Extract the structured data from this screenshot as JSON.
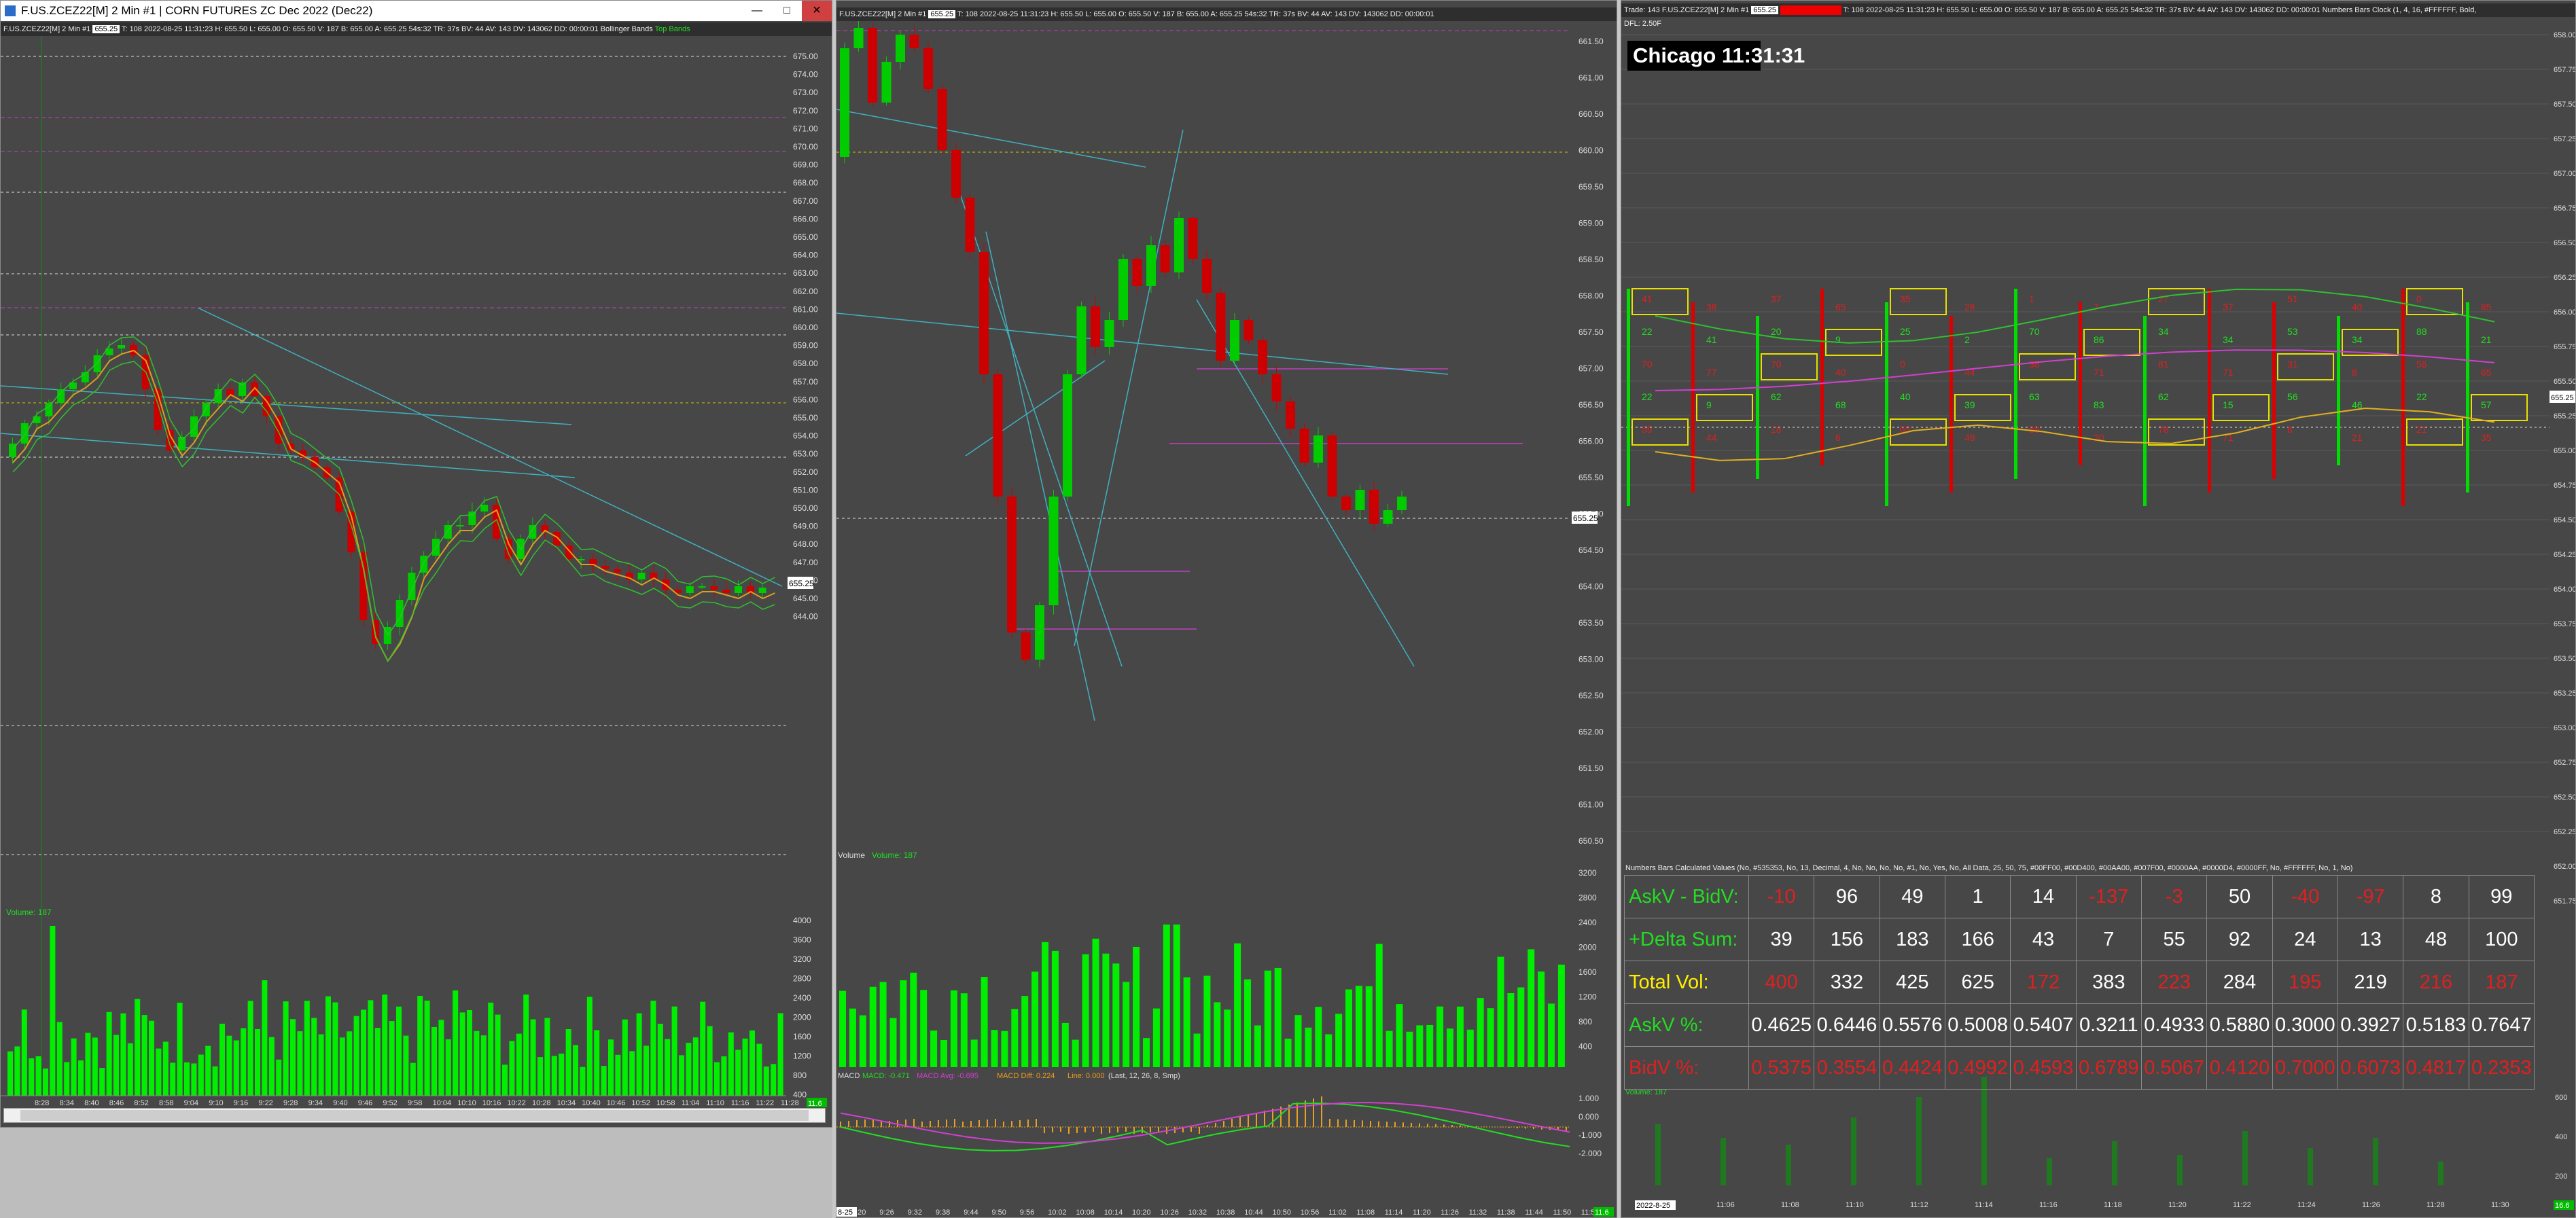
{
  "window1": {
    "title": "F.US.ZCEZ22[M]  2 Min   #1 | CORN FUTURES ZC Dec 2022 (Dec22)",
    "info_symbol": "F.US.ZCEZ22[M]  2 Min  #1",
    "info_price_badge": "655.25",
    "info_rest": "T: 108   2022-08-25 11:31:23 H: 655.50 L: 655.00 O: 655.50 V: 187 B: 655.00 A: 655.25 54s:32 TR: 37s BV: 44 AV: 143 DV: 143062 DD: 00:00:01",
    "indicator": "Bollinger Bands",
    "indicator_flag": "Top Bands",
    "price_labels": [
      "675.00",
      "674.00",
      "673.00",
      "672.00",
      "671.00",
      "670.00",
      "669.00",
      "668.00",
      "667.00",
      "666.00",
      "665.00",
      "664.00",
      "663.00",
      "662.00",
      "661.00",
      "660.00",
      "659.00",
      "658.00",
      "657.00",
      "656.00",
      "655.00",
      "654.00",
      "653.00",
      "652.00",
      "651.00",
      "650.00",
      "649.00",
      "648.00",
      "647.00",
      "646.00",
      "645.00",
      "644.00"
    ],
    "last_price_tag": "655.25",
    "volume_label": "Volume: 187",
    "volume_labels": [
      "4000",
      "3600",
      "3200",
      "2800",
      "2400",
      "2000",
      "1600",
      "1200",
      "800",
      "400"
    ],
    "time_labels": [
      "8:28",
      "8:34",
      "8:40",
      "8:46",
      "8:52",
      "8:58",
      "9:04",
      "9:10",
      "9:16",
      "9:22",
      "9:28",
      "9:34",
      "9:40",
      "9:46",
      "9:52",
      "9:58",
      "10:04",
      "10:10",
      "10:16",
      "10:22",
      "10:28",
      "10:34",
      "10:40",
      "10:46",
      "10:52",
      "10:58",
      "11:04",
      "11:10",
      "11:16",
      "11:22",
      "11:28"
    ],
    "zoom_tag": "11.6"
  },
  "window2": {
    "info_symbol": "F.US.ZCEZ22[M]  2 Min  #1",
    "info_price_badge": "655.25",
    "info_rest": "T: 108   2022-08-25 11:31:23 H: 655.50 L: 655.00 O: 655.50 V: 187 B: 655.00 A: 655.25 54s:32 TR: 37s BV: 44 AV: 143 DV: 143062 DD: 00:00:01",
    "price_labels": [
      "661.50",
      "661.00",
      "660.50",
      "660.00",
      "659.50",
      "659.00",
      "658.50",
      "658.00",
      "657.50",
      "657.00",
      "656.50",
      "656.00",
      "655.50",
      "655.00",
      "654.50",
      "654.00",
      "653.50",
      "653.00",
      "652.50",
      "652.00",
      "651.50",
      "651.00",
      "650.50"
    ],
    "last_price_tag": "655.25",
    "volume_label": "Volume",
    "volume_value": "Volume: 187",
    "volume_labels": [
      "3200",
      "2800",
      "2400",
      "2000",
      "1600",
      "1200",
      "800",
      "400"
    ],
    "macd_label": "MACD",
    "macd_line": "MACD: -0.471",
    "macd_avg": "MACD Avg: -0.695",
    "macd_diff": "MACD Diff: 0.224",
    "macd_zero": "Line: 0.000",
    "macd_params": "(Last, 12, 26, 8, Smp)",
    "macd_axis": [
      "1.000",
      "0.000",
      "-1.000",
      "-2.000"
    ],
    "time_labels": [
      "9:20",
      "9:26",
      "9:32",
      "9:38",
      "9:44",
      "9:50",
      "9:56",
      "10:02",
      "10:08",
      "10:14",
      "10:20",
      "10:26",
      "10:32",
      "10:38",
      "10:44",
      "10:50",
      "10:56",
      "11:02",
      "11:08",
      "11:14",
      "11:20",
      "11:26",
      "11:32",
      "11:38",
      "11:44",
      "11:50",
      "11:56"
    ],
    "date_tag": "8-25",
    "zoom_tag": "11.6"
  },
  "window3": {
    "info_trade": "Trade: 143",
    "info_symbol": "F.US.ZCEZ22[M]  2 Min  #1",
    "info_price_badge": "655.25",
    "info_rest": "T: 108   2022-08-25 11:31:23 H: 655.50 L: 655.00 O: 655.50 V: 187 B: 655.00 A: 655.25 54s:32 TR: 37s BV: 44 AV: 143 DV: 143062 DD: 00:00:01",
    "info_study": "Numbers Bars  Clock   (1, 4, 16, #FFFFFF, Bold,",
    "info_line2": "DFL: 2.50F",
    "clock": "Chicago 11:31:31",
    "price_labels": [
      "658.00",
      "657.75",
      "657.50",
      "657.25",
      "657.00",
      "656.75",
      "656.50",
      "656.25",
      "656.00",
      "655.75",
      "655.50",
      "655.25",
      "655.00",
      "654.75",
      "654.50",
      "654.25",
      "654.00",
      "653.75",
      "653.50",
      "653.25",
      "653.00",
      "652.75",
      "652.50",
      "652.25",
      "652.00",
      "651.75"
    ],
    "last_price_tag": "655.25",
    "calc_header": "Numbers Bars Calculated Values  (No, #535353, No, 13, Decimal, 4, No, No, No, No, #1, No, Yes, No, All Data, 25, 50, 75, #00FF00, #00D400, #00AA00, #007F00, #0000AA, #0000D4, #0000FF, No, #FFFFFF, No, 1, No)",
    "stats": {
      "rows": [
        {
          "label": "AskV - BidV:",
          "label_color": "#22dd22",
          "values": [
            "-10",
            "96",
            "49",
            "1",
            "14",
            "-137",
            "-3",
            "50",
            "-40",
            "-97",
            "8",
            "99"
          ],
          "colors": [
            "#e02020",
            "#ffffff",
            "#ffffff",
            "#ffffff",
            "#ffffff",
            "#e02020",
            "#e02020",
            "#ffffff",
            "#e02020",
            "#e02020",
            "#ffffff",
            "#ffffff"
          ]
        },
        {
          "label": "+Delta Sum:",
          "label_color": "#22dd22",
          "values": [
            "39",
            "156",
            "183",
            "166",
            "43",
            "7",
            "55",
            "92",
            "24",
            "13",
            "48",
            "100"
          ],
          "colors": [
            "#ffffff",
            "#ffffff",
            "#ffffff",
            "#ffffff",
            "#ffffff",
            "#ffffff",
            "#ffffff",
            "#ffffff",
            "#ffffff",
            "#ffffff",
            "#ffffff",
            "#ffffff"
          ]
        },
        {
          "label": "Total Vol:",
          "label_color": "#ffee00",
          "values": [
            "400",
            "332",
            "425",
            "625",
            "172",
            "383",
            "223",
            "284",
            "195",
            "219",
            "216",
            "187"
          ],
          "colors": [
            "#e02020",
            "#ffffff",
            "#ffffff",
            "#ffffff",
            "#e02020",
            "#ffffff",
            "#e02020",
            "#ffffff",
            "#e02020",
            "#ffffff",
            "#e02020",
            "#e02020"
          ]
        },
        {
          "label": "AskV %:",
          "label_color": "#22dd22",
          "values": [
            "0.4625",
            "0.6446",
            "0.5576",
            "0.5008",
            "0.5407",
            "0.3211",
            "0.4933",
            "0.5880",
            "0.3000",
            "0.3927",
            "0.5183",
            "0.7647"
          ],
          "colors": [
            "#ffffff",
            "#ffffff",
            "#ffffff",
            "#ffffff",
            "#ffffff",
            "#ffffff",
            "#ffffff",
            "#ffffff",
            "#ffffff",
            "#ffffff",
            "#ffffff",
            "#ffffff"
          ]
        },
        {
          "label": "BidV %:",
          "label_color": "#e02020",
          "values": [
            "0.5375",
            "0.3554",
            "0.4424",
            "0.4992",
            "0.4593",
            "0.6789",
            "0.5067",
            "0.4120",
            "0.7000",
            "0.6073",
            "0.4817",
            "0.2353"
          ],
          "colors": [
            "#e02020",
            "#e02020",
            "#e02020",
            "#e02020",
            "#e02020",
            "#e02020",
            "#e02020",
            "#e02020",
            "#e02020",
            "#e02020",
            "#e02020",
            "#e02020"
          ]
        }
      ]
    },
    "volume_label": "Volume: 187",
    "volume_axis": [
      "600",
      "400",
      "200"
    ],
    "time_labels": [
      "11:06",
      "11:08",
      "11:10",
      "11:12",
      "11:14",
      "11:16",
      "11:18",
      "11:20",
      "11:22",
      "11:24",
      "11:26",
      "11:28",
      "11:30"
    ],
    "date_tag": "2022-8-25",
    "zoom_tag": "16.6"
  },
  "colors": {
    "up": "#00dd00",
    "down": "#cc0000",
    "panel": "#474747",
    "grid": "#5a5a5a"
  },
  "icons": [
    "window-icon",
    "minimize-icon",
    "maximize-icon",
    "close-icon"
  ]
}
